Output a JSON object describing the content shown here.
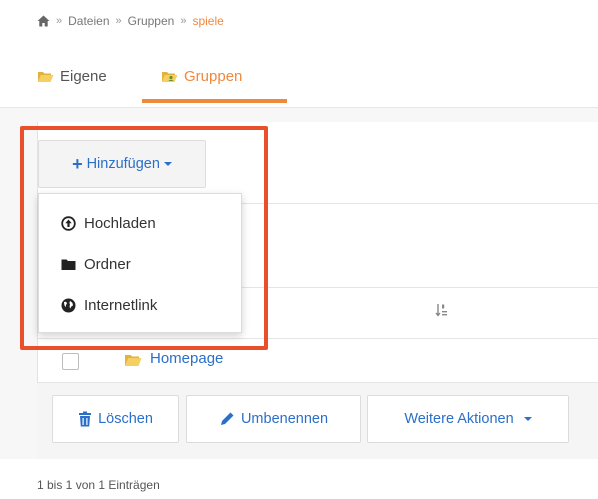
{
  "breadcrumb": {
    "items": [
      "Dateien",
      "Gruppen",
      "spiele"
    ],
    "separator": "»",
    "home_icon": "home-icon"
  },
  "tabs": {
    "own_label": "Eigene",
    "groups_label": "Gruppen",
    "active": "Gruppen"
  },
  "toolbar": {
    "add_label": "Hinzufügen"
  },
  "add_menu": {
    "upload_label": "Hochladen",
    "folder_label": "Ordner",
    "link_label": "Internetlink"
  },
  "table": {
    "rows": [
      {
        "name": "Homepage",
        "type": "folder"
      }
    ]
  },
  "actions": {
    "delete_label": "Löschen",
    "rename_label": "Umbenennen",
    "more_label": "Weitere Aktionen"
  },
  "footer": {
    "entries_text": "1 bis 1 von 1 Einträgen"
  },
  "colors": {
    "accent": "#f0883e",
    "link": "#2a6fc9",
    "highlight": "#ea4f2c"
  }
}
